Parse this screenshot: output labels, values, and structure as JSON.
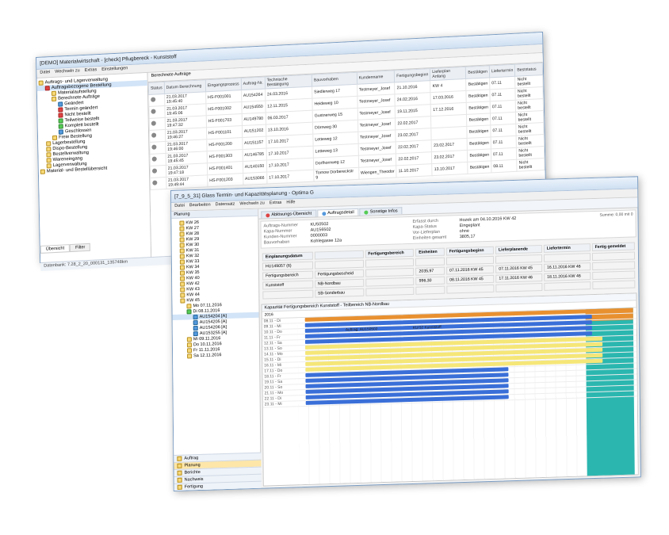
{
  "backWin": {
    "title": "[DEMO] Materialwirtschaft - [check] Pflugbereck - Kunststoff",
    "menu": [
      "Datei",
      "Wechseln zu",
      "Extras",
      "Einstellungen"
    ],
    "tabLabel": "Berechnete Aufträge",
    "tree": [
      {
        "lvl": 0,
        "txt": "Auftrags- und Lagerverwaltung",
        "ic": ""
      },
      {
        "lvl": 1,
        "txt": "Auftragsbezogene Bestellung",
        "sel": true,
        "ic": "red"
      },
      {
        "lvl": 2,
        "txt": "Materialaufstellung",
        "ic": ""
      },
      {
        "lvl": 2,
        "txt": "Berechnete Aufträge",
        "ic": ""
      },
      {
        "lvl": 3,
        "txt": "Geändert",
        "ic": "blue"
      },
      {
        "lvl": 3,
        "txt": "Termin geändert",
        "ic": "red"
      },
      {
        "lvl": 3,
        "txt": "Nicht bestellt",
        "ic": "red"
      },
      {
        "lvl": 3,
        "txt": "Teilweise bestellt",
        "ic": "green"
      },
      {
        "lvl": 3,
        "txt": "Komplett bestellt",
        "ic": "green"
      },
      {
        "lvl": 3,
        "txt": "Geschlossen",
        "ic": "blue"
      },
      {
        "lvl": 2,
        "txt": "Freie Bestellung",
        "ic": ""
      },
      {
        "lvl": 1,
        "txt": "Lagerbestellung",
        "ic": ""
      },
      {
        "lvl": 1,
        "txt": "Dispo-Bestellung",
        "ic": ""
      },
      {
        "lvl": 1,
        "txt": "Bestellverwaltung",
        "ic": ""
      },
      {
        "lvl": 1,
        "txt": "Wareneingang",
        "ic": ""
      },
      {
        "lvl": 1,
        "txt": "Lagerverwaltung",
        "ic": ""
      },
      {
        "lvl": 0,
        "txt": "Material- und Bestellübersicht",
        "ic": ""
      }
    ],
    "cols": [
      "Status",
      "Datum Berechnung",
      "Eingangsprozess",
      "Auftrag-Nr.",
      "Technische Bestätigung",
      "Bauvorhaben",
      "Kundenname",
      "Fertigungsbeginn",
      "Lieferplan Anfang",
      "Bestätigen",
      "Liefertermin",
      "Beststatus"
    ],
    "rows": [
      {
        "d": "21.03.2017 19:45:40",
        "ep": "HS-F001001",
        "an": "AU154264",
        "tb": "24.03.2016",
        "bv": "Siedlerweg 17",
        "kn": "Testmeyer_Josef",
        "fb": "21.10.2016",
        "la": "KW 4",
        "best": "Bestätigen",
        "lt": "07.11",
        "bs": "Nicht bestellt"
      },
      {
        "d": "21.03.2017 19:45:06",
        "ep": "HS-F001002",
        "an": "AU154550",
        "tb": "12.11.2015",
        "bv": "Heideweg 10",
        "kn": "Testmeyer_Josef",
        "fb": "24.02.2016",
        "la": "17.03.2016",
        "best": "Bestätigen",
        "lt": "07.11",
        "bs": "Nicht bestellt"
      },
      {
        "d": "21.03.2017 19:47:32",
        "ep": "HS-F001703",
        "an": "AU149780",
        "tb": "06.03.2017",
        "bv": "Gustnerweg 15",
        "kn": "Testmeyer_Josef",
        "fb": "19.11.2015",
        "la": "17.12.2016",
        "best": "Bestätigen",
        "lt": "07.11",
        "bs": "Nicht bestellt"
      },
      {
        "d": "21.03.2017 19:46:27",
        "ep": "HS-F001101",
        "an": "AU151202",
        "tb": "13.10.2016",
        "bv": "Dörnweg 30",
        "kn": "Testmeyer_Josef",
        "fb": "22.02.2017",
        "la": "",
        "best": "Bestätigen",
        "lt": "07.11",
        "bs": "Nicht bestellt"
      },
      {
        "d": "21.03.2017 19:46:00",
        "ep": "HS-F001200",
        "an": "AU151157",
        "tb": "17.10.2017",
        "bv": "Letteweg 12",
        "kn": "Testmeyer_Josef",
        "fb": "23.02.2017",
        "la": "",
        "best": "Bestätigen",
        "lt": "07.11",
        "bs": "Nicht bestellt"
      },
      {
        "d": "21.03.2017 19:45:45",
        "ep": "HS-F001303",
        "an": "AU146785",
        "tb": "17.10.2017",
        "bv": "Letteweg 13",
        "kn": "Testmeyer_Josef",
        "fb": "22.02.2017",
        "la": "23.02.2017",
        "best": "Bestätigen",
        "lt": "07.11",
        "bs": "Nicht bestellt"
      },
      {
        "d": "21.03.2017 19:47:18",
        "ep": "HS-F001401",
        "an": "AU140150",
        "tb": "17.10.2017",
        "bv": "Dorfhornweg 12",
        "kn": "Testmeyer_Josef",
        "fb": "22.02.2017",
        "la": "23.02.2017",
        "best": "Bestätigen",
        "lt": "07.11",
        "bs": "Nicht bestellt"
      },
      {
        "d": "21.03.2017 19:49:44",
        "ep": "HS-F001203",
        "an": "AU153066",
        "tb": "17.10.2017",
        "bv": "Tornow Dorbereckstr 9",
        "kn": "Wiengen_Theodor",
        "fb": "11.10.2017",
        "la": "13.10.2017",
        "best": "Bestätigen",
        "lt": "08.11",
        "bs": "Nicht bestellt"
      }
    ],
    "bottomTabs": [
      "Übersicht",
      "Filter"
    ],
    "statusbar": "Datenbank: 7.28_2_20_000131_135748km"
  },
  "frontWin": {
    "title": "[7_9_5_31] Glass Termin- und Kapazitätsplanung - Optima G",
    "menu": [
      "Datei",
      "Bearbeiten",
      "Datensatz",
      "Wechseln zu",
      "Extras",
      "Hilfe"
    ],
    "treeHdr": "Planung",
    "tree": [
      {
        "txt": "KW 26"
      },
      {
        "txt": "KW 27"
      },
      {
        "txt": "KW 28"
      },
      {
        "txt": "KW 29"
      },
      {
        "txt": "KW 30"
      },
      {
        "txt": "KW 31"
      },
      {
        "txt": "KW 32"
      },
      {
        "txt": "KW 33"
      },
      {
        "txt": "KW 34"
      },
      {
        "txt": "KW 35"
      },
      {
        "txt": "KW 40"
      },
      {
        "txt": "KW 42"
      },
      {
        "txt": "KW 43"
      },
      {
        "txt": "KW 44"
      },
      {
        "txt": "KW 45",
        "open": true
      },
      {
        "txt": "Mo 07.11.2016",
        "lvl": 1
      },
      {
        "txt": "Di 08.11.2016",
        "lvl": 1,
        "ic": "green"
      },
      {
        "txt": "AU154204 [A]",
        "lvl": 2,
        "sel": true,
        "ic": "blue"
      },
      {
        "txt": "AU154205 [A]",
        "lvl": 2,
        "ic": "blue"
      },
      {
        "txt": "AU154206 [A]",
        "lvl": 2,
        "ic": "blue"
      },
      {
        "txt": "AU153255 [A]",
        "lvl": 2,
        "ic": "blue"
      },
      {
        "txt": "Mi 09.11.2016",
        "lvl": 1
      },
      {
        "txt": "Do 10.11.2016",
        "lvl": 1
      },
      {
        "txt": "Fr 11.11.2016",
        "lvl": 1
      },
      {
        "txt": "Sa 12.11.2016",
        "lvl": 1
      }
    ],
    "tabs": [
      {
        "lbl": "Ablösungs-Übersicht",
        "ic": "r"
      },
      {
        "lbl": "Auftragsdetail",
        "ic": "b",
        "active": true
      },
      {
        "lbl": "Sonstige Infos",
        "ic": "g"
      }
    ],
    "info": {
      "l1_lbl": "Auftrags-Nummer",
      "l1_val": "KU50502",
      "l2_lbl": "Erfasst durch",
      "l2_val": "Hozek am 04.10.2016 KW 42",
      "l3_lbl": "Kapa-Nummer",
      "l3_val": "AU156502",
      "l4_lbl": "Kapa-Status",
      "l4_val": "Eingeplant",
      "l5_lbl": "Kunden-Nummer",
      "l5_val": "0000003",
      "l6_lbl": "Vor-Lieferplan",
      "l6_val": "ohne",
      "l7_lbl": "Bauvorhaben",
      "l7_val": "Kohlegasse 12a",
      "l8_lbl": "Einheiten gesamt",
      "l8_val": "3805,17"
    },
    "summaryLbl": "Summe: 0,00 mit 0",
    "sub": {
      "cols": [
        "Einplanungsdatum",
        "",
        "Fertigungsbereich",
        "Einheiten",
        "Fertigungsbeginn",
        "Lieferplanende",
        "Liefertermin",
        "Fertig gemeldet"
      ],
      "rows": [
        {
          "d": "HU149057 (6)",
          "b": "",
          "e": "",
          "fb": "",
          "le": "",
          "lt": "",
          "fg": ""
        },
        {
          "d": "Fertigungsbereich",
          "b": "Fertigungsbescheid",
          "e": "2035,97",
          "fb": "07.11.2016 KW 45",
          "le": "07.11.2016 KW 45",
          "lt": "16.11.2016 KW 46",
          "fg": ""
        },
        {
          "d": "Kunststoff",
          "b": "NB-Nordbau",
          "e": "996,30",
          "fb": "08.11.2016 KW 45",
          "le": "17.11.2016 KW 46",
          "lt": "18.11.2016 KW 46",
          "fg": ""
        },
        {
          "d": "",
          "b": "SB-Sonderbau",
          "e": "",
          "fb": "",
          "le": "",
          "lt": "",
          "fg": ""
        }
      ]
    },
    "ganttTitle": "Kapazität Fertigungsbereich Kunststoff - Teilbereich NB-Nordbau",
    "ganttYearRow": "2016",
    "ganttLabels": [
      "Auftrag: AU150502",
      "KU/32 Kunststoff"
    ],
    "dates": [
      "08.11 - Di",
      "09.11 - Mi",
      "10.11 - Do",
      "11.11 - Fr",
      "12.11 - Sa",
      "13.11 - So",
      "14.11 - Mo",
      "15.11 - Di",
      "16.11 - Mi",
      "17.11 - Do",
      "18.11 - Fr",
      "19.11 - Sa",
      "20.11 - So",
      "21.11 - Mo",
      "22.11 - Di",
      "23.11 - Mi"
    ],
    "sideTabs": [
      "Auftrag",
      "Planung",
      "Berichte",
      "Nachweis",
      "Fertigung"
    ]
  }
}
